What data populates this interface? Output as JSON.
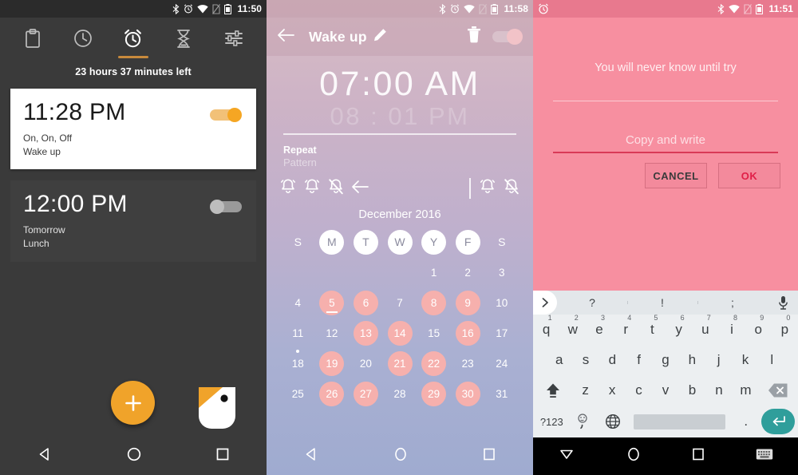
{
  "panel1": {
    "statusbar": {
      "icons": [
        "bluetooth-icon",
        "alarm-icon",
        "wifi-icon",
        "no-sim-icon",
        "battery-icon"
      ],
      "time": "11:50"
    },
    "tabs": [
      {
        "name": "tab-clipboard",
        "icon": "clipboard-icon",
        "active": false
      },
      {
        "name": "tab-clock",
        "icon": "clock-icon",
        "active": false
      },
      {
        "name": "tab-alarm",
        "icon": "alarm-clock-icon",
        "active": true
      },
      {
        "name": "tab-timer",
        "icon": "hourglass-icon",
        "active": false
      },
      {
        "name": "tab-settings",
        "icon": "sliders-icon",
        "active": false
      }
    ],
    "countdown": "23 hours 37 minutes  left",
    "alarms": [
      {
        "time": "11:28 PM",
        "repeat": "On, On, Off",
        "label": "Wake up",
        "enabled": true
      },
      {
        "time": "12:00 PM",
        "repeat": "Tomorrow",
        "label": "Lunch",
        "enabled": false
      }
    ],
    "fab": {
      "icon": "plus-icon",
      "label": "Add alarm"
    },
    "app_logo": "app-logo-icon",
    "nav": [
      "back-icon",
      "home-icon",
      "recents-icon"
    ],
    "accent": "#f0a32a"
  },
  "panel2": {
    "statusbar": {
      "icons": [
        "bluetooth-icon",
        "alarm-icon",
        "wifi-icon",
        "no-sim-icon",
        "battery-icon"
      ],
      "time": "11:58"
    },
    "appbar": {
      "back": "back-arrow-icon",
      "title": "Wake up",
      "edit": "pencil-icon",
      "delete": "trash-icon",
      "toggle_on": true
    },
    "time": {
      "hour": "07",
      "sep": ":",
      "minute": "00",
      "meridiem": "AM",
      "ghost": "08 : 01 PM"
    },
    "repeat": {
      "label": "Repeat",
      "value": "Pattern"
    },
    "bells": [
      "bell-on-icon",
      "bell-on-icon",
      "bell-off-icon",
      "undo-arrow-icon"
    ],
    "bells_right": [
      "bell-on-icon",
      "bell-off-icon"
    ],
    "month": "December 2016",
    "day_headers": [
      "S",
      "M",
      "T",
      "W",
      "Y",
      "F",
      "S"
    ],
    "day_headers_selected": [
      false,
      true,
      true,
      true,
      true,
      true,
      false
    ],
    "weeks": [
      [
        null,
        null,
        null,
        null,
        1,
        2,
        3
      ],
      [
        4,
        5,
        6,
        7,
        8,
        9,
        10
      ],
      [
        11,
        12,
        13,
        14,
        15,
        16,
        17
      ],
      [
        18,
        19,
        20,
        21,
        22,
        23,
        24
      ],
      [
        25,
        26,
        27,
        28,
        29,
        30,
        31
      ]
    ],
    "marked_days": [
      5,
      6,
      8,
      9,
      13,
      14,
      16,
      19,
      21,
      22,
      26,
      27,
      29,
      30
    ],
    "today": 5,
    "dotted_day": 18,
    "nav": [
      "back-icon",
      "home-icon",
      "recents-icon"
    ]
  },
  "panel3": {
    "statusbar": {
      "left_icons": [
        "alarm-app-icon"
      ],
      "icons": [
        "bluetooth-icon",
        "wifi-icon",
        "no-sim-icon",
        "battery-icon"
      ],
      "time": "11:51"
    },
    "quote": "You will never know until try",
    "input": {
      "placeholder": "Copy and write",
      "value": ""
    },
    "buttons": {
      "cancel": "CANCEL",
      "ok": "OK"
    },
    "ok_color": "#e01f48",
    "keyboard": {
      "suggestions": [
        "?",
        "!",
        ";"
      ],
      "expand_icon": "chevron-right-icon",
      "mic_icon": "microphone-icon",
      "row1": [
        {
          "k": "q",
          "n": "1"
        },
        {
          "k": "w",
          "n": "2"
        },
        {
          "k": "e",
          "n": "3"
        },
        {
          "k": "r",
          "n": "4"
        },
        {
          "k": "t",
          "n": "5"
        },
        {
          "k": "y",
          "n": "6"
        },
        {
          "k": "u",
          "n": "7"
        },
        {
          "k": "i",
          "n": "8"
        },
        {
          "k": "o",
          "n": "9"
        },
        {
          "k": "p",
          "n": "0"
        }
      ],
      "row2": [
        "a",
        "s",
        "d",
        "f",
        "g",
        "h",
        "j",
        "k",
        "l"
      ],
      "row3": [
        "z",
        "x",
        "c",
        "v",
        "b",
        "n",
        "m"
      ],
      "shift_icon": "shift-icon",
      "backspace_icon": "backspace-icon",
      "symbols_key": "?123",
      "emoji_key": ",",
      "globe_icon": "globe-icon",
      "period_key": ".",
      "enter_icon": "enter-icon"
    },
    "nav": [
      "hide-keyboard-icon",
      "home-icon",
      "recents-icon",
      "keyboard-switch-icon"
    ]
  }
}
